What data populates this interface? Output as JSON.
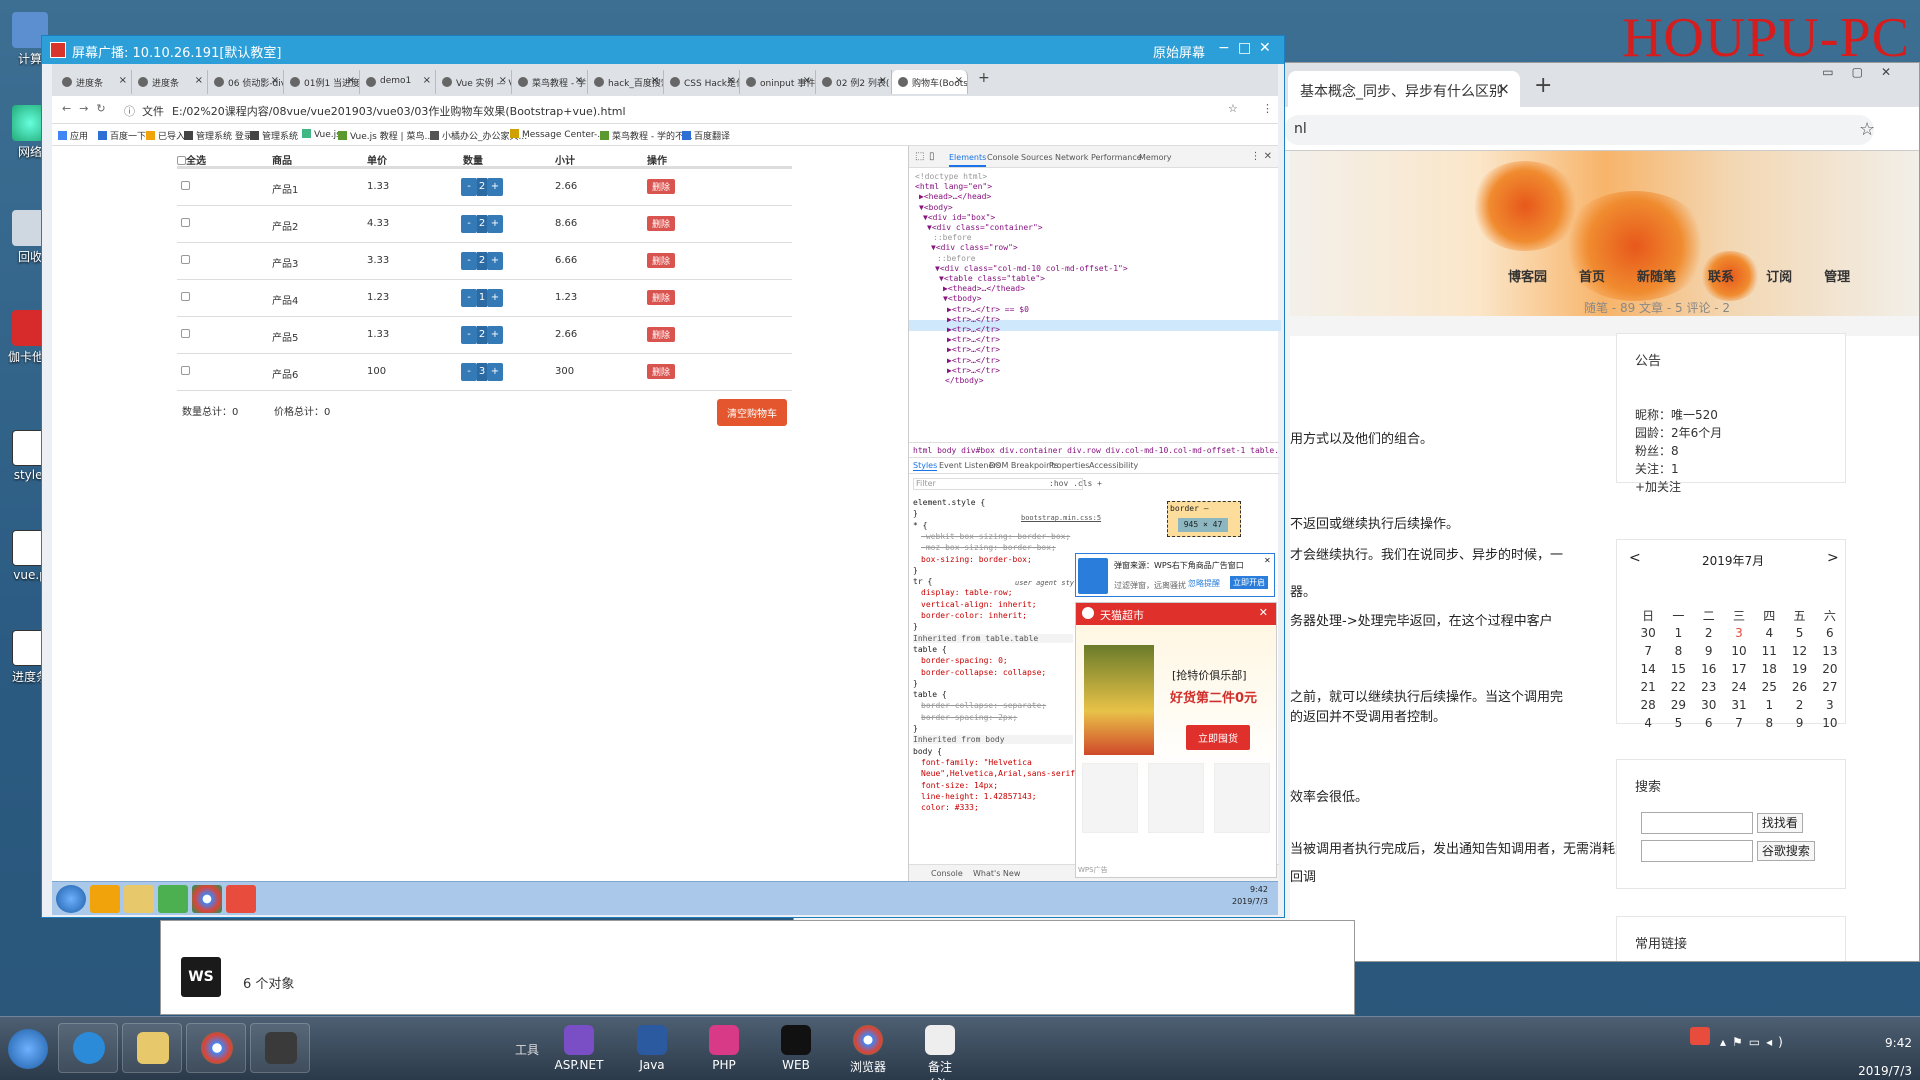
{
  "watermark": "HOUPU-PC",
  "desktop": {
    "icons": [
      "计算",
      "网络",
      "回收",
      "伽卡他-教室学",
      "style.",
      "vue.p",
      "进度条"
    ]
  },
  "bg_browser": {
    "tab_title": "基本概念_同步、异步有什么区别",
    "url_tail": "nl",
    "blog_nav": [
      "博客园",
      "首页",
      "新随笔",
      "联系",
      "订阅",
      "管理"
    ],
    "blog_stats": "随笔 - 89  文章 - 5  评论 - 2",
    "notice_title": "公告",
    "profile": [
      "昵称：唯一520",
      "园龄：2年6个月",
      "粉丝：8",
      "关注：1",
      "+加关注"
    ],
    "calendar_title": "2019年7月",
    "calendar_prev": "<",
    "calendar_next": ">",
    "weekdays": [
      "日",
      "一",
      "二",
      "三",
      "四",
      "五",
      "六"
    ],
    "calendar_rows": [
      [
        "30",
        "1",
        "2",
        "3",
        "4",
        "5",
        "6"
      ],
      [
        "7",
        "8",
        "9",
        "10",
        "11",
        "12",
        "13"
      ],
      [
        "14",
        "15",
        "16",
        "17",
        "18",
        "19",
        "20"
      ],
      [
        "21",
        "22",
        "23",
        "24",
        "25",
        "26",
        "27"
      ],
      [
        "28",
        "29",
        "30",
        "31",
        "1",
        "2",
        "3"
      ],
      [
        "4",
        "5",
        "6",
        "7",
        "8",
        "9",
        "10"
      ]
    ],
    "search_title": "搜索",
    "search_btn": "找找看",
    "google_btn": "谷歌搜索",
    "links_title": "常用链接",
    "article_lines": [
      "用方式以及他们的组合。",
      "不返回或继续执行后续操作。",
      "才会继续执行。我们在说同步、异步的时候，一",
      "器。",
      "务器处理->处理完毕返回，在这个过程中客户",
      "之前，就可以继续执行后续操作。当这个调用完",
      "的返回并不受调用者控制。",
      "效率会很低。",
      "当被调用者执行完成后，发出通知告知调用者，无需消耗太多性能。",
      "回调"
    ]
  },
  "explorer": {
    "status": "6 个对象"
  },
  "broadcast": {
    "title": "屏幕广播: 10.10.26.191[默认教室]",
    "original": "原始屏幕",
    "tabs": [
      "进度条",
      "进度条",
      "06 侦动影-div",
      "01例1 当进度",
      "demo1",
      "Vue 实例 — V",
      "菜鸟教程 - 学",
      "hack_百度搜索",
      "CSS Hack是什",
      "oninput 事件",
      "02 例2 列表(",
      "购物车(Bootst"
    ],
    "url_prefix": "文件",
    "url": "E:/02%20课程内容/08vue/vue201903/vue03/03作业购物车效果(Bootstrap+vue).html",
    "bookmarks": [
      "应用",
      "百度一下",
      "已导入",
      "管理系统 登录",
      "管理系统",
      "Vue.js",
      "Vue.js 教程 | 菜鸟...",
      "小橘办公_办公家具...",
      "Message Center-...",
      "菜鸟教程 - 学的不...",
      "百度翻译"
    ],
    "cart": {
      "headers": [
        "全选",
        "商品",
        "单价",
        "数量",
        "小计",
        "操作"
      ],
      "minus": "-",
      "plus": "+",
      "delete": "删除",
      "rows": [
        {
          "name": "产品1",
          "price": "1.33",
          "qty": "2",
          "subtotal": "2.66"
        },
        {
          "name": "产品2",
          "price": "4.33",
          "qty": "2",
          "subtotal": "8.66"
        },
        {
          "name": "产品3",
          "price": "3.33",
          "qty": "2",
          "subtotal": "6.66"
        },
        {
          "name": "产品4",
          "price": "1.23",
          "qty": "1",
          "subtotal": "1.23"
        },
        {
          "name": "产品5",
          "price": "1.33",
          "qty": "2",
          "subtotal": "2.66"
        },
        {
          "name": "产品6",
          "price": "100",
          "qty": "3",
          "subtotal": "300"
        }
      ],
      "total_count": "数量总计：0",
      "total_price": "价格总计：0",
      "clear_btn": "清空购物车"
    },
    "devtools": {
      "tabs": [
        "Elements",
        "Console",
        "Sources",
        "Network",
        "Performance",
        "Memory"
      ],
      "dom": [
        "<!doctype html>",
        "<html lang=\"en\">",
        "▶<head>…</head>",
        "▼<body>",
        "▼<div id=\"box\">",
        "▼<div class=\"container\">",
        "::before",
        "▼<div class=\"row\">",
        "::before",
        "▼<div class=\"col-md-10 col-md-offset-1\">",
        "▼<table class=\"table\">",
        "▶<thead>…</thead>",
        "▼<tbody>",
        "▶<tr>…</tr> == $0",
        "▶<tr>…</tr>",
        "▶<tr>…</tr>",
        "▶<tr>…</tr>",
        "▶<tr>…</tr>",
        "▶<tr>…</tr>",
        "▶<tr>…</tr>",
        "</tbody>"
      ],
      "breadcrumb": "html  body  div#box  div.container  div.row  div.col-md-10.col-md-offset-1  table.table  tbody  tr",
      "subtabs": [
        "Styles",
        "Event Listeners",
        "DOM Breakpoints",
        "Properties",
        "Accessibility"
      ],
      "filter": "Filter",
      "filter_tools": ":hov  .cls  +",
      "styles": [
        "element.style {",
        "}",
        "* {",
        "-webkit-box-sizing: border-box;",
        "-moz-box-sizing: border-box;",
        "box-sizing: border-box;",
        "}",
        "tr {",
        "display: table-row;",
        "vertical-align: inherit;",
        "border-color: inherit;",
        "}",
        "Inherited from table.table",
        "table {",
        "border-spacing: 0;",
        "border-collapse: collapse;",
        "}",
        "table {",
        "border-collapse: separate;",
        "border-spacing: 2px;",
        "}",
        "Inherited from body",
        "body {",
        "font-family: \"Helvetica",
        "Neue\",Helvetica,Arial,sans-serif;",
        "font-size: 14px;",
        "line-height: 1.42857143;",
        "color: #333;"
      ],
      "source": "bootstrap.min.css:5",
      "user_agent": "user agent stylesheet",
      "box_label": "border –",
      "box_size": "945 × 47",
      "console_tabs": [
        "Console",
        "What's New"
      ]
    },
    "wps": {
      "source": "弹窗来源：WPS右下角商品广告窗口",
      "line2": "过滤弹窗，远离骚扰",
      "ignore": "忽略提醒",
      "close": "立即开启"
    },
    "tmall": {
      "title": "天猫超市",
      "promo1": "[抢特价俱乐部]",
      "promo2": "好货第二件0元",
      "cta": "立即囤货",
      "footer": "WPS广告"
    },
    "inner_clock": [
      "9:42",
      "2019/7/3"
    ]
  },
  "taskbar": {
    "group_label": "工具",
    "apps": [
      "ASP.NET",
      "Java",
      "PHP",
      "WEB",
      "浏览器",
      "备注（必..."
    ],
    "time": "9:42",
    "date": "2019/7/3"
  },
  "colors": {
    "broadcast_title": "#2d9fd8",
    "bootstrap_primary": "#337ab7",
    "danger": "#d9534f",
    "clear_btn": "#e4572e",
    "tmall_red": "#e0302c",
    "watermark": "#d61d1d"
  }
}
